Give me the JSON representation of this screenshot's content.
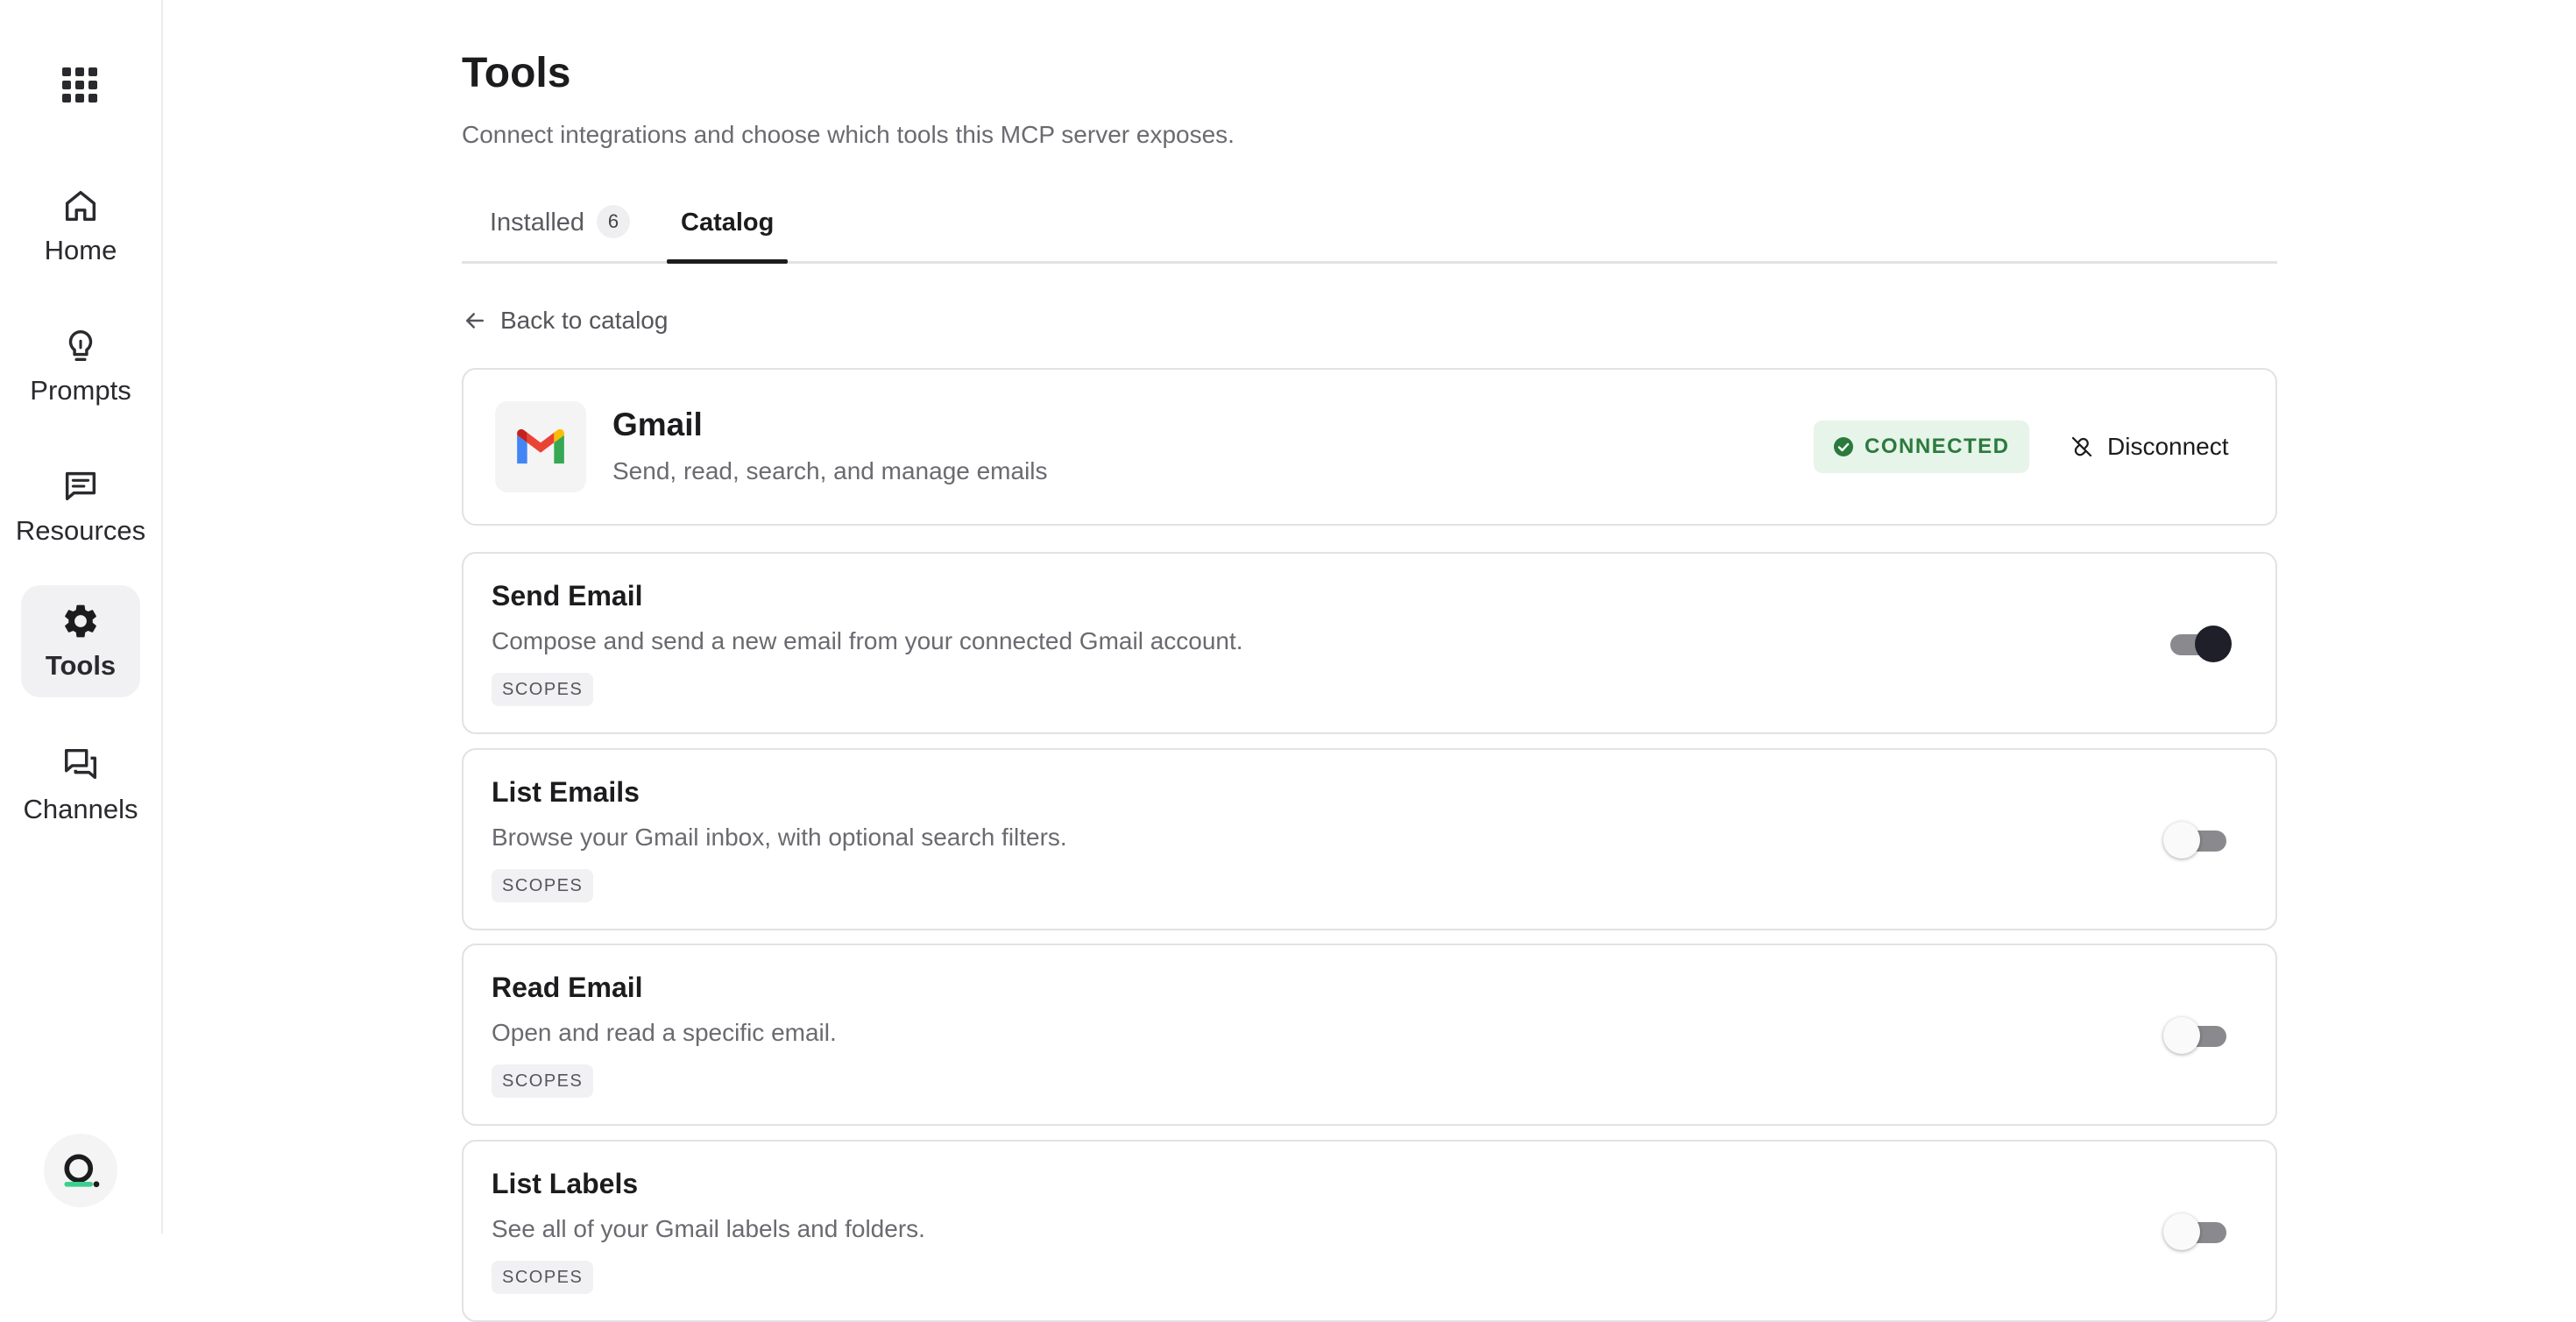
{
  "sidebar": {
    "items": [
      {
        "label": "Home",
        "icon": "home-icon"
      },
      {
        "label": "Prompts",
        "icon": "lightbulb-icon"
      },
      {
        "label": "Resources",
        "icon": "message-square-icon"
      },
      {
        "label": "Tools",
        "icon": "gear-icon",
        "active": true
      },
      {
        "label": "Channels",
        "icon": "chat-bubbles-icon"
      }
    ]
  },
  "page": {
    "title": "Tools",
    "subtitle": "Connect integrations and choose which tools this MCP server exposes."
  },
  "tabs": {
    "installed_label": "Installed",
    "installed_count": "6",
    "catalog_label": "Catalog",
    "active": "Catalog"
  },
  "back_link": "Back to catalog",
  "integration": {
    "name": "Gmail",
    "description": "Send, read, search, and manage emails",
    "status": "CONNECTED",
    "status_color": "#2b7a3d",
    "disconnect_label": "Disconnect"
  },
  "tools": [
    {
      "name": "Send Email",
      "description": "Compose and send a new email from your connected Gmail account.",
      "scope_label": "SCOPES",
      "enabled": true
    },
    {
      "name": "List Emails",
      "description": "Browse your Gmail inbox, with optional search filters.",
      "scope_label": "SCOPES",
      "enabled": false
    },
    {
      "name": "Read Email",
      "description": "Open and read a specific email.",
      "scope_label": "SCOPES",
      "enabled": false
    },
    {
      "name": "List Labels",
      "description": "See all of your Gmail labels and folders.",
      "scope_label": "SCOPES",
      "enabled": false
    }
  ]
}
